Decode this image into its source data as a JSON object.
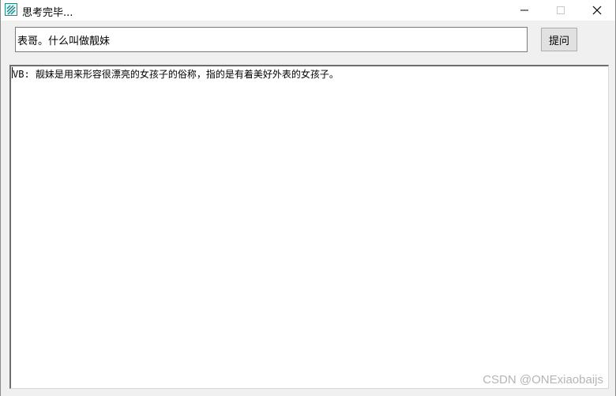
{
  "window": {
    "title": "思考完毕...",
    "controls": [
      "minimize",
      "maximize",
      "close"
    ]
  },
  "question": {
    "value": "表哥。什么叫做靓妹"
  },
  "ask_button": {
    "label": "提问"
  },
  "answer": {
    "text": "VB: 靓妹是用来形容很漂亮的女孩子的俗称，指的是有着美好外表的女孩子。"
  },
  "watermark": {
    "text": "CSDN @ONExiaobaijs"
  },
  "colors": {
    "icon_teal": "#1f8a8a"
  }
}
